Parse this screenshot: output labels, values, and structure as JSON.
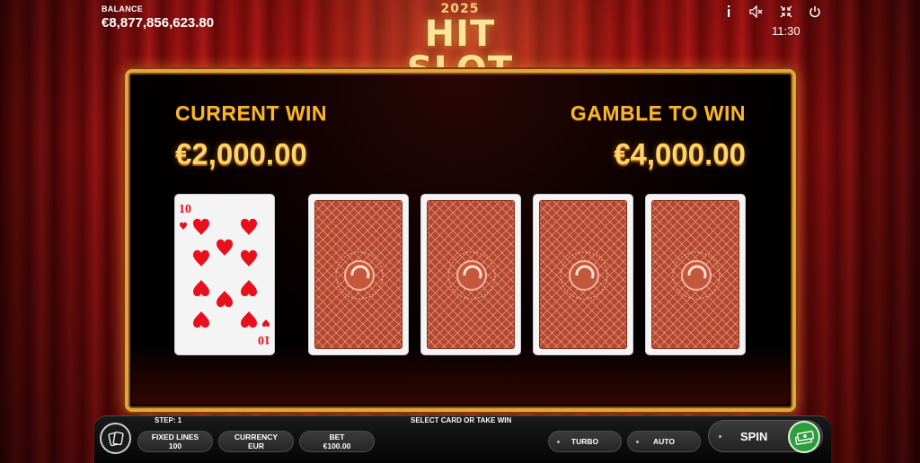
{
  "balance": {
    "label": "BALANCE",
    "value": "€8,877,856,623.80"
  },
  "logo": {
    "year": "2025",
    "name": "HIT SLOT"
  },
  "top_icons": [
    "info-icon",
    "sound-muted-icon",
    "fullscreen-exit-icon",
    "power-icon"
  ],
  "clock": "11:30",
  "gamble": {
    "current_win_label": "CURRENT WIN",
    "current_win_amount": "€2,000.00",
    "gamble_label": "GAMBLE TO WIN",
    "gamble_amount": "€4,000.00",
    "revealed_card": {
      "rank": "10",
      "suit": "hearts"
    },
    "hidden_cards": 4
  },
  "bottom": {
    "step": "STEP: 1",
    "prompt": "SELECT CARD OR TAKE WIN",
    "fixed_lines_label": "FIXED LINES",
    "fixed_lines_value": "100",
    "currency_label": "CURRENCY",
    "currency_value": "EUR",
    "bet_label": "BET",
    "bet_value": "€100.00",
    "turbo_label": "TURBO",
    "auto_label": "AUTO",
    "spin_label": "SPIN"
  },
  "colors": {
    "gold": "#f6b629",
    "panel_border": "#e3a53b",
    "card_back": "#b3482f",
    "heart": "#e8101c",
    "cash_green": "#2e9e3c"
  }
}
